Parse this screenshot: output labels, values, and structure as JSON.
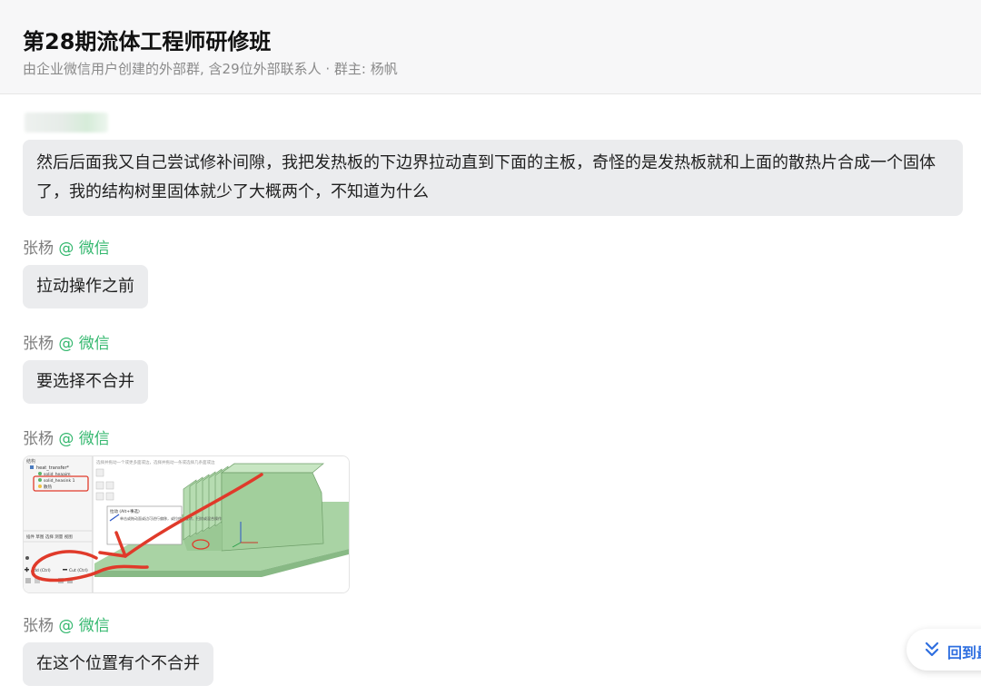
{
  "header": {
    "title": "第28期流体工程师研修班",
    "subtitle": "由企业微信用户创建的外部群, 含29位外部联系人 · 群主: 杨帆"
  },
  "messages": [
    {
      "text": "然后后面我又自己尝试修补间隙，我把发热板的下边界拉动直到下面的主板，奇怪的是发热板就和上面的散热片合成一个固体了，我的结构树里固体就少了大概两个，不知道为什么"
    },
    {
      "sender": "张杨",
      "source": "@ 微信",
      "text": "拉动操作之前"
    },
    {
      "sender": "张杨",
      "source": "@ 微信",
      "text": "要选择不合并"
    },
    {
      "sender": "张杨",
      "source": "@ 微信",
      "image": "cad-screenshot-thumbnail"
    },
    {
      "sender": "张杨",
      "source": "@ 微信",
      "text": "在这个位置有个不合并"
    }
  ],
  "screenshot_image": {
    "tree_root": "heat_transfer*",
    "tree_items": [
      "solid_heaaim",
      "solid_heasink 1",
      "散热"
    ],
    "panel_tabs": "插件 草图 选择 测量 视图",
    "add_label": "Add (Ctrl)",
    "cut_label": "Cut (Ctrl)",
    "hint_text": "选择并拖动一个或更多面或边，选择并拖动一条或选择几条面或边",
    "tooltip_title": "拉动 (Alt+事选)",
    "tooltip_body": "单击或拖动面或边可进行偏移，或拉伸、旋转、扫掠或混合操作"
  },
  "back_button": {
    "label": "回到最新",
    "icon": "double-chevron-down-icon"
  },
  "colors": {
    "accent_blue": "#2f6fe0",
    "wechat_green": "#35b86f",
    "bubble_bg": "#ebecee",
    "annotation_red": "#e03a2a"
  }
}
